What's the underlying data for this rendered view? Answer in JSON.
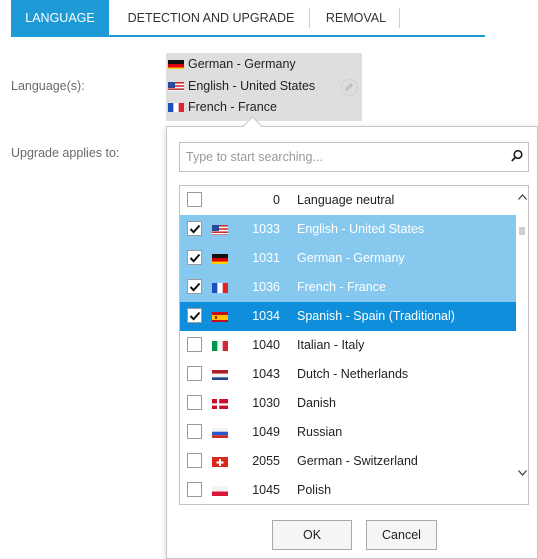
{
  "tabs": [
    {
      "label": "LANGUAGE"
    },
    {
      "label": "DETECTION AND UPGRADE"
    },
    {
      "label": "REMOVAL"
    }
  ],
  "form": {
    "languages_label": "Language(s):",
    "upgrade_label": "Upgrade applies to:"
  },
  "selected_languages": [
    {
      "name": "German - Germany",
      "flag": "germany-flag"
    },
    {
      "name": "English - United States",
      "flag": "usa-flag"
    },
    {
      "name": "French - France",
      "flag": "france-flag"
    }
  ],
  "search": {
    "placeholder": "Type to start searching...",
    "icon": "search-icon"
  },
  "list": [
    {
      "code": "0",
      "name": "Language neutral",
      "checked": false,
      "state": "normal",
      "flag": ""
    },
    {
      "code": "1033",
      "name": "English - United States",
      "checked": true,
      "state": "selected",
      "flag": "usa-flag"
    },
    {
      "code": "1031",
      "name": "German - Germany",
      "checked": true,
      "state": "selected",
      "flag": "germany-flag"
    },
    {
      "code": "1036",
      "name": "French - France",
      "checked": true,
      "state": "selected",
      "flag": "france-flag"
    },
    {
      "code": "1034",
      "name": "Spanish - Spain (Traditional)",
      "checked": true,
      "state": "current",
      "flag": "spain-flag"
    },
    {
      "code": "1040",
      "name": "Italian - Italy",
      "checked": false,
      "state": "normal",
      "flag": "italy-flag"
    },
    {
      "code": "1043",
      "name": "Dutch - Netherlands",
      "checked": false,
      "state": "normal",
      "flag": "netherlands-flag"
    },
    {
      "code": "1030",
      "name": "Danish",
      "checked": false,
      "state": "normal",
      "flag": "denmark-flag"
    },
    {
      "code": "1049",
      "name": "Russian",
      "checked": false,
      "state": "normal",
      "flag": "russia-flag"
    },
    {
      "code": "2055",
      "name": "German - Switzerland",
      "checked": false,
      "state": "normal",
      "flag": "switzerland-flag"
    },
    {
      "code": "1045",
      "name": "Polish",
      "checked": false,
      "state": "normal",
      "flag": "poland-flag"
    }
  ],
  "buttons": {
    "ok": "OK",
    "cancel": "Cancel"
  },
  "colors": {
    "accent": "#1e9ad6",
    "selected_row": "#87c9ee",
    "current_row": "#0f8fdb"
  }
}
